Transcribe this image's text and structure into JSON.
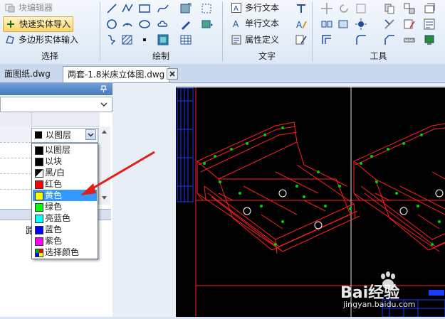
{
  "ribbon": {
    "selection_group": {
      "label": "选择",
      "block_editor": "块编辑器",
      "quick_import": "快速实体导入",
      "polygon_input": "多边形实体输入"
    },
    "draw_group": {
      "label": "绘制"
    },
    "text_group": {
      "label": "文字",
      "multiline_text": "多行文本",
      "single_text": "单行文本",
      "attribute_define": "属性定义"
    },
    "tools_group": {
      "label": "工具"
    }
  },
  "tabs": [
    {
      "label": "面图纸.dwg"
    },
    {
      "label": "两套-1.8米床立体图.dwg"
    }
  ],
  "properties": {
    "color_combo_value": "以图层"
  },
  "color_options": [
    {
      "label": "以图层",
      "swatch": "#000000"
    },
    {
      "label": "以块",
      "swatch": "#000000"
    },
    {
      "label": "黑/白",
      "swatch": "#000000"
    },
    {
      "label": "红色",
      "swatch": "#ff0000"
    },
    {
      "label": "黄色",
      "swatch": "#ffff00"
    },
    {
      "label": "绿色",
      "swatch": "#00ff00"
    },
    {
      "label": "亮蓝色",
      "swatch": "#00ffff"
    },
    {
      "label": "蓝色",
      "swatch": "#0000ff"
    },
    {
      "label": "紫色",
      "swatch": "#ff00ff"
    },
    {
      "label": "选择颜色",
      "swatch": "multicolor"
    }
  ],
  "selected_option": "黄色",
  "panel_partial_text": "路",
  "watermark": {
    "text": "Bai经验",
    "url": "jingyan.baidu.com"
  },
  "colors": {
    "accent_red": "#e0201a",
    "drawing_red": "#ff1e1e",
    "drawing_green": "#00d000"
  }
}
